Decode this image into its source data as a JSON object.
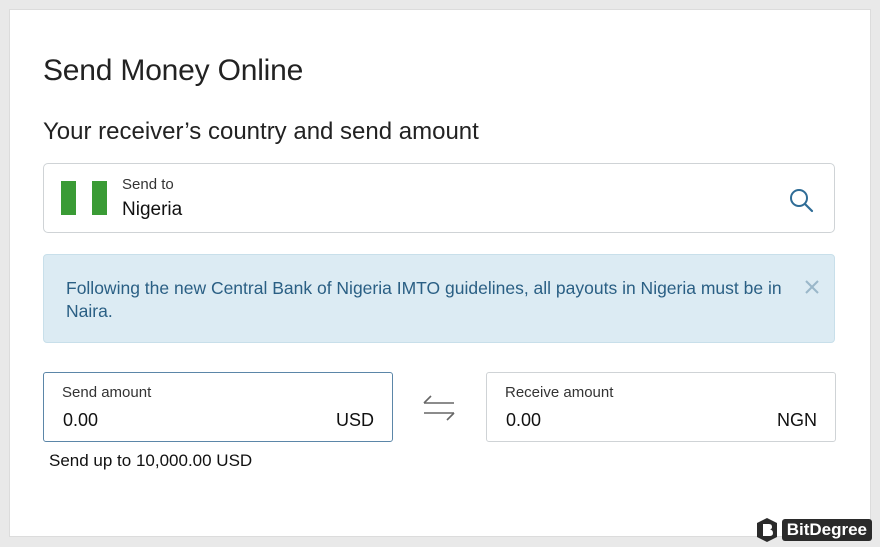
{
  "page": {
    "title": "Send Money Online",
    "section_title": "Your receiver’s country and send amount"
  },
  "country": {
    "label": "Send to",
    "value": "Nigeria",
    "flag_colors": [
      "#3a9b35",
      "#ffffff",
      "#3a9b35"
    ],
    "icon": "search-icon"
  },
  "notice": {
    "text": "Following the new Central Bank of Nigeria IMTO guidelines, all payouts in Nigeria must be in Naira.",
    "icon": "close-icon",
    "background": "#dcebf3",
    "text_color": "#2a5f84"
  },
  "send": {
    "label": "Send amount",
    "value": "0.00",
    "currency": "USD",
    "limit_text": "Send up to 10,000.00 USD"
  },
  "swap": {
    "icon": "swap-arrows-icon"
  },
  "receive": {
    "label": "Receive amount",
    "value": "0.00",
    "currency": "NGN"
  },
  "watermark": {
    "text": "BitDegree"
  }
}
